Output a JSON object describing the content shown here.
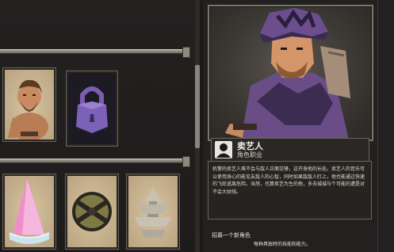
{
  "character": {
    "name": "卖艺人",
    "role": "角色职业",
    "description": "机警的卖艺人难不会与敌人正面交锋，这开身他的长处。卖艺人的音乐可以使用身心的能见友敌人的心智，同时如果敌敌人盯上，他也能通过快速的飞轮逃离危险。当然，也算卖艺为生的他，多去城城与个可能的遭是对不会大姑钱。",
    "unlock_hint": "招募一个新角色",
    "unlock_hint_2": "每种具独特的技能和能力。"
  },
  "cards": [
    {
      "name": "barbarian-card",
      "style": "parch"
    },
    {
      "name": "lock-card",
      "style": "dark"
    },
    {
      "name": "wizard-hat-card",
      "style": "parch"
    },
    {
      "name": "shield-card",
      "style": "parch"
    },
    {
      "name": "pagoda-card",
      "style": "parch"
    }
  ]
}
